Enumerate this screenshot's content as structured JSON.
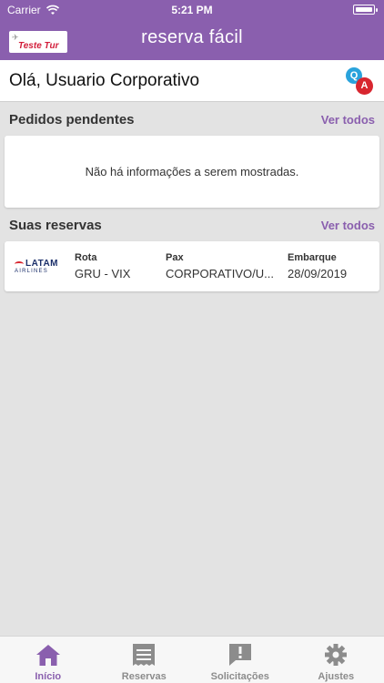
{
  "status_bar": {
    "carrier": "Carrier",
    "time": "5:21 PM"
  },
  "header": {
    "logo_text": "Teste Tur",
    "brand": "reserva fácil"
  },
  "greeting": {
    "text": "Olá, Usuario Corporativo"
  },
  "qa_badge": {
    "q": "Q",
    "a": "A"
  },
  "pending": {
    "title": "Pedidos pendentes",
    "see_all": "Ver todos",
    "empty_message": "Não há informações a serem mostradas."
  },
  "reservations": {
    "title": "Suas reservas",
    "see_all": "Ver todos",
    "items": [
      {
        "airline_logo": "LATAM",
        "airline_sub": "AIRLINES",
        "route_label": "Rota",
        "route": "GRU - VIX",
        "pax_label": "Pax",
        "pax": "CORPORATIVO/U...",
        "boarding_label": "Embarque",
        "boarding": "28/09/2019"
      }
    ]
  },
  "tabs": [
    {
      "label": "Início",
      "icon": "home-icon",
      "active": true
    },
    {
      "label": "Reservas",
      "icon": "receipt-icon",
      "active": false
    },
    {
      "label": "Solicitações",
      "icon": "alert-message-icon",
      "active": false
    },
    {
      "label": "Ajustes",
      "icon": "gear-icon",
      "active": false
    }
  ],
  "colors": {
    "accent": "#8a5fae",
    "background": "#e3e3e3",
    "tab_inactive": "#8c8c8c"
  }
}
